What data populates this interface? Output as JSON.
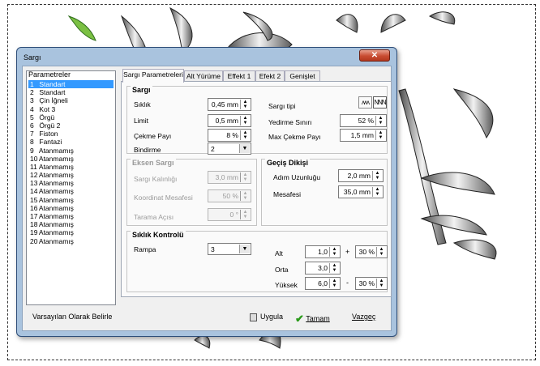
{
  "dialog": {
    "title": "Sargı",
    "close_glyph": "✕"
  },
  "params": {
    "header": "Parametreler",
    "items": [
      {
        "num": "1",
        "label": "Standart"
      },
      {
        "num": "2",
        "label": "Standart"
      },
      {
        "num": "3",
        "label": "Çin İğneli"
      },
      {
        "num": "4",
        "label": "Kot 3"
      },
      {
        "num": "5",
        "label": "Örgü"
      },
      {
        "num": "6",
        "label": "Örgü 2"
      },
      {
        "num": "7",
        "label": "Fiston"
      },
      {
        "num": "8",
        "label": "Fantazi"
      },
      {
        "num": "9",
        "label": "Atanmamış"
      },
      {
        "num": "10",
        "label": "Atanmamış"
      },
      {
        "num": "11",
        "label": "Atanmamış"
      },
      {
        "num": "12",
        "label": "Atanmamış"
      },
      {
        "num": "13",
        "label": "Atanmamış"
      },
      {
        "num": "14",
        "label": "Atanmamış"
      },
      {
        "num": "15",
        "label": "Atanmamış"
      },
      {
        "num": "16",
        "label": "Atanmamış"
      },
      {
        "num": "17",
        "label": "Atanmamış"
      },
      {
        "num": "18",
        "label": "Atanmamış"
      },
      {
        "num": "19",
        "label": "Atanmamış"
      },
      {
        "num": "20",
        "label": "Atanmamış"
      }
    ],
    "selected_index": 0
  },
  "tabs": [
    "Sargı Parametreleri",
    "Alt Yürüme",
    "Effekt 1",
    "Efekt 2",
    "Genişlet"
  ],
  "sargi": {
    "title": "Sargı",
    "siklik_label": "Sıklık",
    "siklik_value": "0,45 mm",
    "limit_label": "Limit",
    "limit_value": "0,5 mm",
    "cekme_label": "Çekme Payı",
    "cekme_value": "8 %",
    "bindirme_label": "Bindirme",
    "bindirme_value": "2",
    "tipi_label": "Sargı tipi",
    "yedirme_label": "Yedirme Sınırı",
    "yedirme_value": "52 %",
    "maxcekme_label": "Max Çekme Payı",
    "maxcekme_value": "1,5 mm",
    "type_glyphs": [
      "ʌʌʌ",
      "ΝΝΝ"
    ]
  },
  "eksen": {
    "title": "Eksen Sargı",
    "kalinlik_label": "Sargı Kalınlığı",
    "kalinlik_value": "3,0 mm",
    "koordinat_label": "Koordinat Mesafesi",
    "koordinat_value": "50 %",
    "tarama_label": "Tarama Açısı",
    "tarama_value": "0 °"
  },
  "gecis": {
    "title": "Geçiş Dikişi",
    "adim_label": "Adım Uzunluğu",
    "adim_value": "2,0 mm",
    "mesafe_label": "Mesafesi",
    "mesafe_value": "35,0 mm"
  },
  "siklik_kontrol": {
    "title": "Sıklık Kontrolü",
    "rampa_label": "Rampa",
    "rampa_value": "3",
    "alt_label": "Alt",
    "alt_value": "1,0",
    "alt_pct": "30 %",
    "plus": "+",
    "orta_label": "Orta",
    "orta_value": "3,0",
    "yuksek_label": "Yüksek",
    "yuksek_value": "6,0",
    "yuksek_pct": "30 %",
    "minus": "-"
  },
  "bottom": {
    "default_label": "Varsayılan Olarak Belirle",
    "apply_label": "Uygula",
    "ok_label": "Tamam",
    "cancel_label": "Vazgeç"
  },
  "colors": {
    "selection": "#3399ff",
    "titlebar": "#a9c3de",
    "close": "#c84b31",
    "ok_check": "#2a9a1a"
  }
}
